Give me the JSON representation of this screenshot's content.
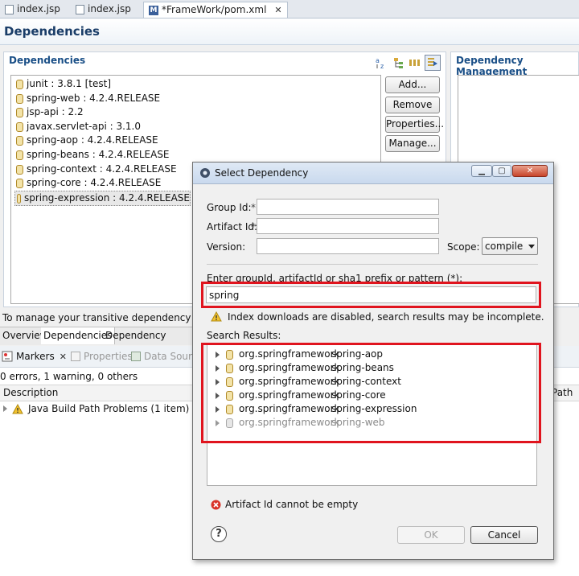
{
  "tabs": [
    {
      "label": "index.jsp"
    },
    {
      "label": "index.jsp"
    },
    {
      "label": "*FrameWork/pom.xml",
      "close": "✕"
    }
  ],
  "page_title": "Dependencies",
  "deps": {
    "title": "Dependencies",
    "items": [
      "junit : 3.8.1 [test]",
      "spring-web : 4.2.4.RELEASE",
      "jsp-api : 2.2",
      "javax.servlet-api : 3.1.0",
      "spring-aop : 4.2.4.RELEASE",
      "spring-beans : 4.2.4.RELEASE",
      "spring-context : 4.2.4.RELEASE",
      "spring-core : 4.2.4.RELEASE",
      "spring-expression : 4.2.4.RELEASE"
    ],
    "buttons": {
      "add": "Add...",
      "remove": "Remove",
      "properties": "Properties...",
      "manage": "Manage..."
    }
  },
  "dep_mgmt": {
    "title": "Dependency Management"
  },
  "transitive_text": "To manage your transitive dependency exclusio",
  "editor_tabs": [
    "Overview",
    "Dependencies",
    "Dependency Hierarch"
  ],
  "views": {
    "tabs": [
      {
        "label": "Markers",
        "close": "✕"
      },
      {
        "label": "Properties"
      },
      {
        "label": "Data Sourc"
      }
    ],
    "summary": "0 errors, 1 warning, 0 others",
    "columns": {
      "description": "Description",
      "path": "Path"
    },
    "row": "Java Build Path Problems (1 item)"
  },
  "dialog": {
    "title": "Select Dependency",
    "group_id_label": "Group Id:",
    "artifact_id_label": "Artifact Id:",
    "required_mark": "*",
    "version_label": "Version:",
    "scope_label": "Scope:",
    "scope_value": "compile",
    "search_prompt": "Enter groupId, artifactId or sha1 prefix or pattern (*):",
    "search_value": "spring",
    "warning": "Index downloads are disabled, search results may be incomplete.",
    "results_label": "Search Results:",
    "results": [
      {
        "group": "org.springframework",
        "artifact": "spring-aop"
      },
      {
        "group": "org.springframework",
        "artifact": "spring-beans"
      },
      {
        "group": "org.springframework",
        "artifact": "spring-context"
      },
      {
        "group": "org.springframework",
        "artifact": "spring-core"
      },
      {
        "group": "org.springframework",
        "artifact": "spring-expression"
      },
      {
        "group": "org.springframework",
        "artifact": "spring-web"
      }
    ],
    "error": "Artifact Id cannot be empty",
    "help": "?",
    "ok": "OK",
    "cancel": "Cancel"
  },
  "colors": {
    "highlight": "#e0141e",
    "section_title": "#1a4f87",
    "page_title": "#1a3d68"
  }
}
